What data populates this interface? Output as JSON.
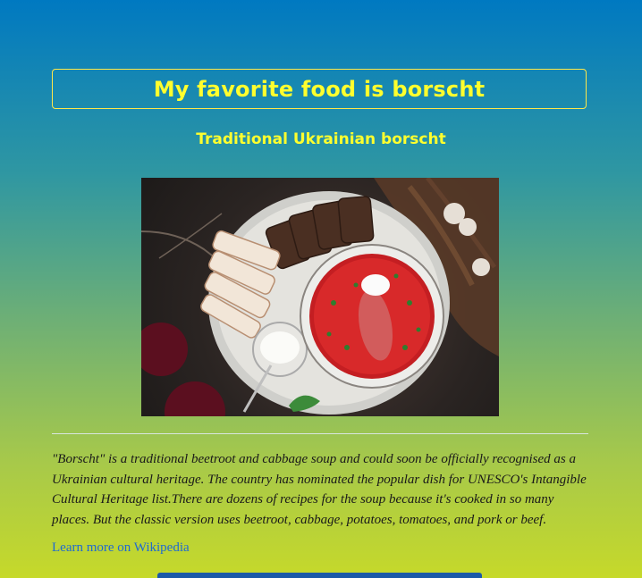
{
  "header": {
    "title": "My favorite food is borscht",
    "subtitle": "Traditional Ukrainian borscht"
  },
  "photo": {
    "alt": "Bowl of red borscht with sour cream, sliced bread and salo on a plate",
    "icon": "food-photo"
  },
  "article": {
    "description": "\"Borscht\" is a traditional beetroot and cabbage soup and could soon be officially recognised as a Ukrainian cultural heritage. The country has nominated the popular dish for UNESCO's Intangible Cultural Heritage list.There are dozens of recipes for the soup because it's cooked in so many places. But the classic version uses beetroot, cabbage, potatoes, tomatoes, and pork or beef.",
    "link_label": "Learn more on Wikipedia"
  },
  "colors": {
    "title": "#ffff2e",
    "link": "#1f6ad1",
    "background_top": "#0079c1",
    "background_bottom": "#c6d92a"
  }
}
